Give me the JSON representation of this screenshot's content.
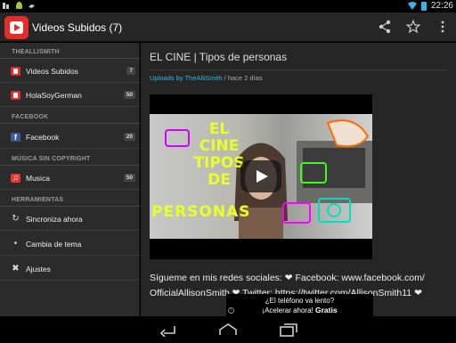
{
  "status_bar": {
    "time": "22:26"
  },
  "app_bar": {
    "title": "Videos Subidos (7)",
    "icons": [
      "youtube-logo-icon",
      "share-icon",
      "star-icon",
      "overflow-menu-icon"
    ]
  },
  "sidebar": {
    "sections": [
      {
        "header": "THEALLISMITH",
        "items": [
          {
            "label": "Videos Subidos",
            "badge": "7",
            "icon": "youtube-icon"
          },
          {
            "label": "HolaSoyGerman",
            "badge": "50",
            "icon": "youtube-icon"
          }
        ]
      },
      {
        "header": "FACEBOOK",
        "items": [
          {
            "label": "Facebook",
            "badge": "20",
            "icon": "facebook-icon"
          }
        ]
      },
      {
        "header": "MÚSICA SIN COPYRIGHT",
        "items": [
          {
            "label": "Musica",
            "badge": "50",
            "icon": "music-icon"
          }
        ]
      },
      {
        "header": "HERRAMIENTAS",
        "items": [
          {
            "label": "Sincroniza ahora",
            "icon": "sync-icon"
          },
          {
            "label": "Cambia de tema",
            "icon": "theme-bulb-icon"
          },
          {
            "label": "Ajustes",
            "icon": "settings-tools-icon"
          }
        ]
      }
    ]
  },
  "main": {
    "title": "EL CINE | Tipos de personas",
    "byline_link": "Uploads by TheAlliSmith",
    "byline_rest": " / hace 2 días",
    "thumbnail_text": [
      "EL",
      "CINE",
      "TIPOS",
      "DE",
      "PERSONAS"
    ],
    "description_line1": "Sígueme en mis redes sociales: ❤ Facebook: www.facebook.com/",
    "description_line2": "OfficialAllisonSmith ❤ Twitter: https://twitter.com/AllisonSmith11 ❤"
  },
  "ad": {
    "line1": "¿El teléfono va lento?",
    "line2_prefix": "¡Acelerar ahora! ",
    "line2_bold": "Gratis"
  },
  "colors": {
    "accent": "#33b5e5",
    "youtube_red": "#e52d27",
    "facebook_blue": "#3b5998"
  }
}
